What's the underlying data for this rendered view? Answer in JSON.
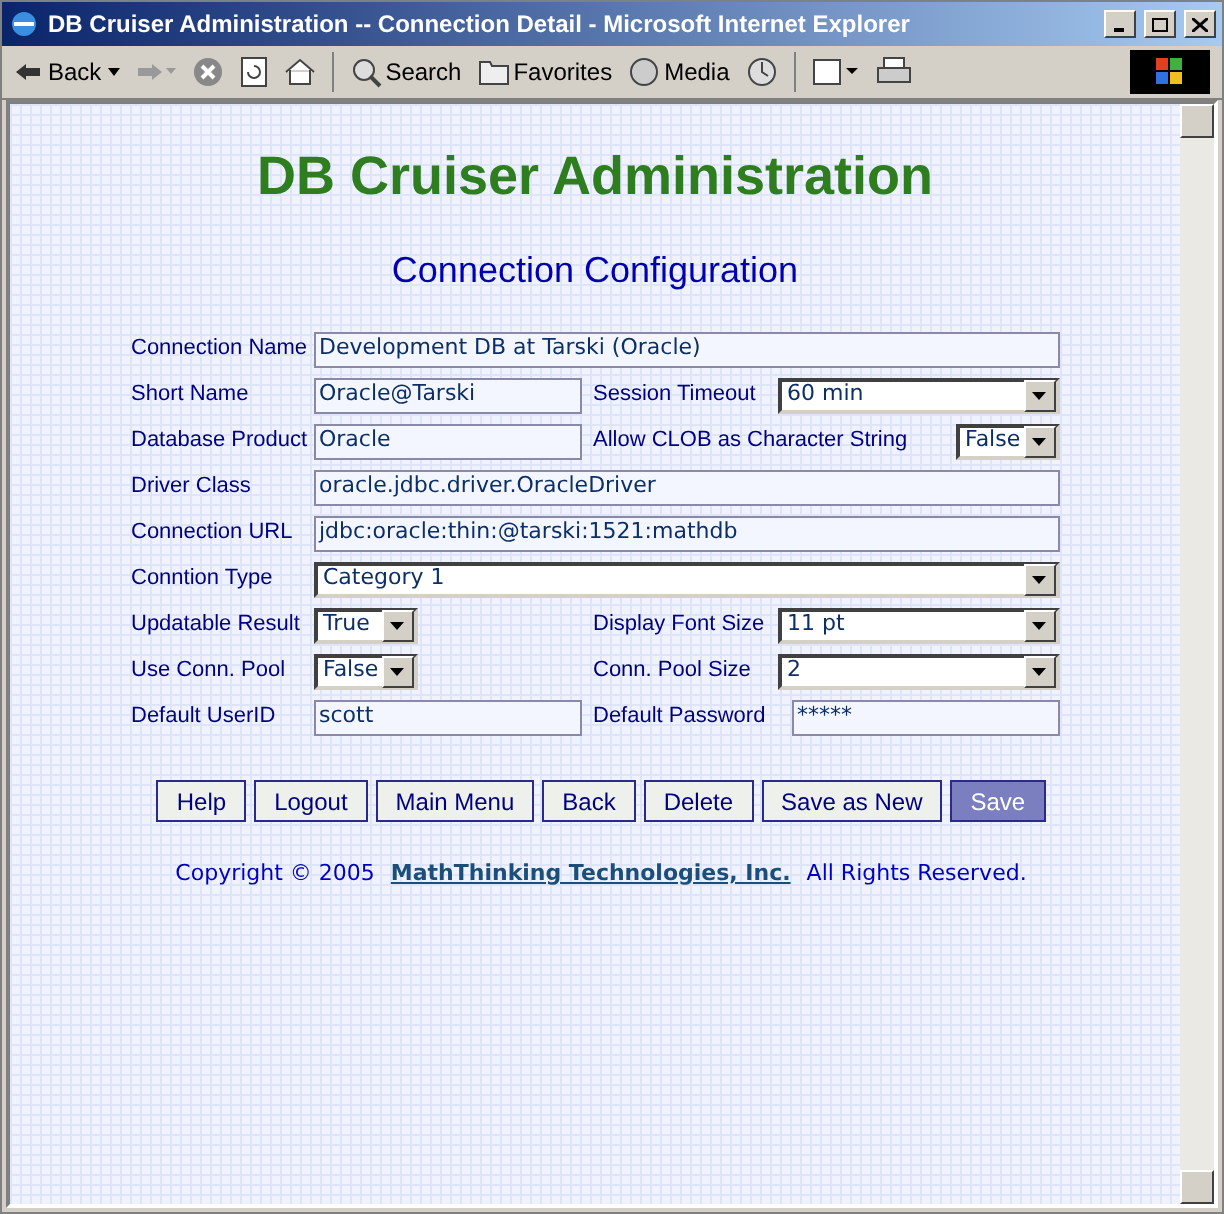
{
  "window": {
    "title": "DB Cruiser Administration -- Connection Detail - Microsoft Internet Explorer"
  },
  "toolbar": {
    "back": "Back",
    "search": "Search",
    "favorites": "Favorites",
    "media": "Media"
  },
  "page": {
    "heading": "DB Cruiser Administration",
    "subheading": "Connection Configuration",
    "rows": [
      {
        "fields": [
          {
            "label": "Connection Name",
            "value": "Development DB at Tarski (Oracle)",
            "kind": "text"
          }
        ]
      },
      {
        "fields": [
          {
            "label": "Short Name",
            "value": "Oracle@Tarski",
            "kind": "text"
          },
          {
            "label": "Session Timeout",
            "value": "60 min",
            "kind": "select"
          }
        ]
      },
      {
        "fields": [
          {
            "label": "Database Product",
            "value": "Oracle",
            "kind": "text"
          },
          {
            "label": "Allow CLOB as Character String",
            "value": "False",
            "kind": "select-small"
          }
        ]
      },
      {
        "fields": [
          {
            "label": "Driver Class",
            "value": "oracle.jdbc.driver.OracleDriver",
            "kind": "text"
          }
        ]
      },
      {
        "fields": [
          {
            "label": "Connection URL",
            "value": "jdbc:oracle:thin:@tarski:1521:mathdb",
            "kind": "text"
          }
        ]
      },
      {
        "fields": [
          {
            "label": "Conntion Type",
            "value": "Category 1",
            "kind": "select"
          }
        ]
      },
      {
        "fields": [
          {
            "label": "Updatable Result",
            "value": "True",
            "kind": "select-small"
          },
          {
            "label": "Display Font Size",
            "value": "11 pt",
            "kind": "select"
          }
        ]
      },
      {
        "fields": [
          {
            "label": "Use Conn. Pool",
            "value": "False",
            "kind": "select-small"
          },
          {
            "label": "Conn. Pool Size",
            "value": "2",
            "kind": "select"
          }
        ]
      },
      {
        "fields": [
          {
            "label": "Default UserID",
            "value": "scott",
            "kind": "text"
          },
          {
            "label": "Default Password",
            "value": "*****",
            "kind": "text"
          }
        ]
      }
    ],
    "buttons": [
      {
        "label": "Help",
        "kind": "normal"
      },
      {
        "label": "Logout",
        "kind": "normal"
      },
      {
        "label": "Main Menu",
        "kind": "normal"
      },
      {
        "label": "Back",
        "kind": "normal"
      },
      {
        "label": "Delete",
        "kind": "normal"
      },
      {
        "label": "Save as New",
        "kind": "normal"
      },
      {
        "label": "Save",
        "kind": "primary"
      }
    ],
    "footer": {
      "prefix": "Copyright © 2005",
      "link": "MathThinking Technologies, Inc.",
      "suffix": "All Rights Reserved."
    }
  }
}
